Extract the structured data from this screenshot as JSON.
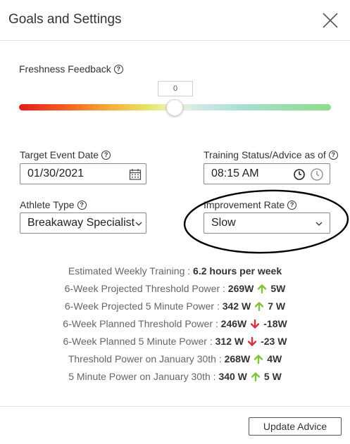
{
  "header": {
    "title": "Goals and Settings"
  },
  "freshness": {
    "label": "Freshness Feedback",
    "value": "0",
    "slider_level_fraction": 0.5
  },
  "target_event": {
    "label": "Target Event Date",
    "value": "01/30/2021"
  },
  "training_status": {
    "label": "Training Status/Advice as of",
    "value": "08:15 AM"
  },
  "athlete_type": {
    "label": "Athlete Type",
    "value": "Breakaway Specialist"
  },
  "improvement_rate": {
    "label": "Improvement Rate",
    "value": "Slow"
  },
  "stats": [
    {
      "label": "Estimated Weekly Training :",
      "value": "6.2 hours per week",
      "change": "",
      "direction": ""
    },
    {
      "label": "6-Week Projected Threshold Power :",
      "value": "269W",
      "change": "5W",
      "direction": "up"
    },
    {
      "label": "6-Week Projected 5 Minute Power :",
      "value": "342 W",
      "change": "7 W",
      "direction": "up"
    },
    {
      "label": "6-Week Planned Threshold Power :",
      "value": "246W",
      "change": "-18W",
      "direction": "down"
    },
    {
      "label": "6-Week Planned 5 Minute Power :",
      "value": "312 W",
      "change": "-23 W",
      "direction": "down"
    },
    {
      "label": "Threshold Power on January 30th :",
      "value": "268W",
      "change": "4W",
      "direction": "up"
    },
    {
      "label": "5 Minute Power on January 30th :",
      "value": "340 W",
      "change": "5 W",
      "direction": "up"
    }
  ],
  "footer": {
    "update_label": "Update Advice"
  },
  "colors": {
    "up_arrow": "#7dc43a",
    "down_arrow": "#d0353f",
    "annotation": "#000000"
  },
  "icons": [
    "close-icon",
    "help-icon",
    "calendar-icon",
    "clock-icon",
    "chevron-down-icon",
    "arrow-up-icon",
    "arrow-down-icon"
  ]
}
